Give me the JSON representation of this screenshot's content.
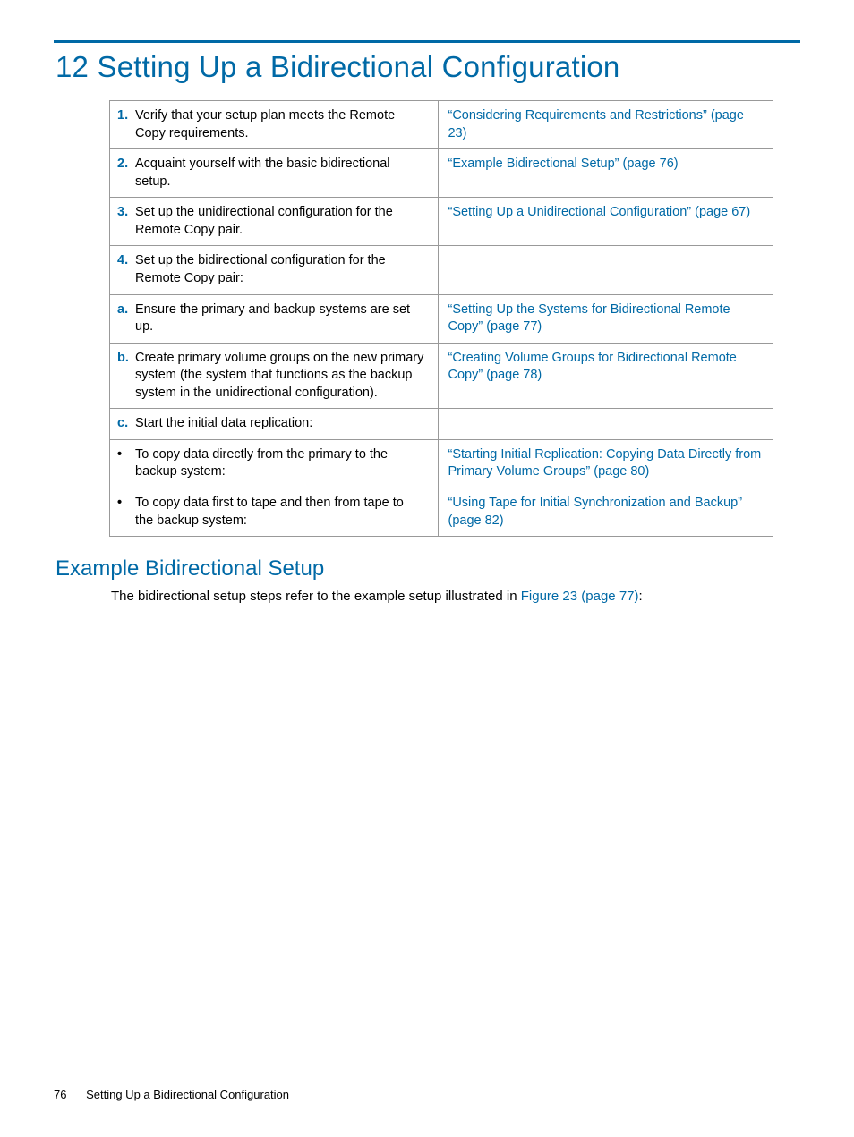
{
  "chapter": {
    "number": "12",
    "title": "Setting Up a Bidirectional Configuration"
  },
  "table": {
    "rows": [
      {
        "marker": "1.",
        "marker_type": "num",
        "left": "Verify that your setup plan meets the Remote Copy requirements.",
        "right_link": "“Considering Requirements and Restrictions” (page 23)"
      },
      {
        "marker": "2.",
        "marker_type": "num",
        "left": "Acquaint yourself with the basic bidirectional setup.",
        "right_link": "“Example Bidirectional Setup” (page 76)"
      },
      {
        "marker": "3.",
        "marker_type": "num",
        "left": "Set up the unidirectional configuration for the Remote Copy pair.",
        "right_link": "“Setting Up a Unidirectional Configuration” (page 67)"
      },
      {
        "marker": "4.",
        "marker_type": "num",
        "left": "Set up the bidirectional configuration for the Remote Copy pair:",
        "right_link": ""
      },
      {
        "marker": "a.",
        "marker_type": "alpha",
        "left": "Ensure the primary and backup systems are set up.",
        "right_link": "“Setting Up the Systems for Bidirectional Remote Copy” (page 77)"
      },
      {
        "marker": "b.",
        "marker_type": "alpha",
        "left": "Create primary volume groups on the new primary system (the system that functions as the backup system in the unidirectional configuration).",
        "right_link": "“Creating Volume Groups for Bidirectional Remote Copy” (page 78)"
      },
      {
        "marker": "c.",
        "marker_type": "alpha",
        "left": "Start the initial data replication:",
        "right_link": ""
      },
      {
        "marker": "•",
        "marker_type": "bullet",
        "left": "To copy data directly from the primary to the backup system:",
        "right_link": "“Starting Initial Replication: Copying Data Directly from Primary Volume Groups” (page 80)"
      },
      {
        "marker": "•",
        "marker_type": "bullet",
        "left": "To copy data first to tape and then from tape to the backup system:",
        "right_link": "“Using Tape for Initial Synchronization and Backup” (page 82)"
      }
    ]
  },
  "section": {
    "heading": "Example Bidirectional Setup",
    "text_before": "The bidirectional setup steps refer to the example setup illustrated in ",
    "link": "Figure 23 (page 77)",
    "text_after": ":"
  },
  "footer": {
    "page": "76",
    "title": "Setting Up a Bidirectional Configuration"
  }
}
